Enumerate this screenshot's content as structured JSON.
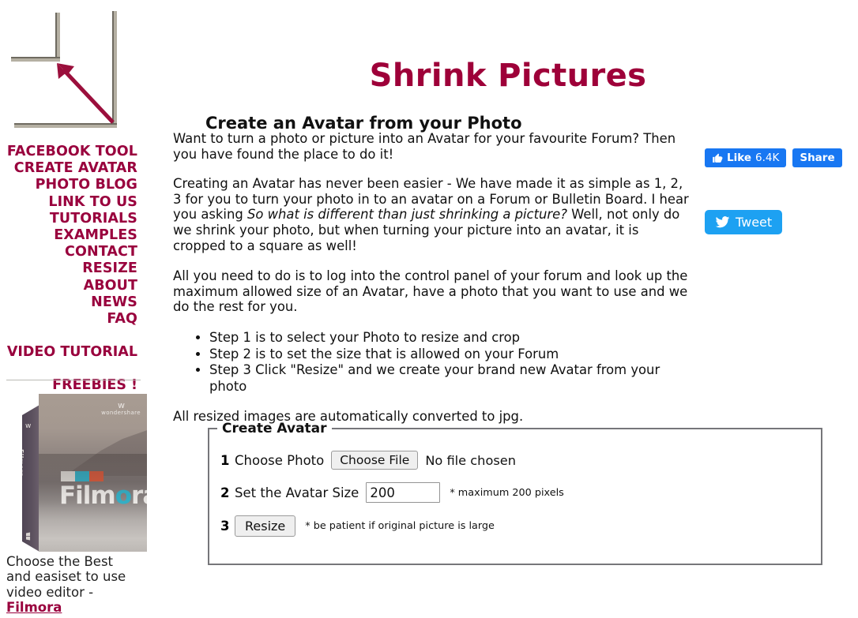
{
  "site": {
    "title": "Shrink Pictures",
    "logo_icon": "shrink-arrow-logo",
    "accent_color": "#99003d",
    "title_color": "#9e0039"
  },
  "sidebar": {
    "nav_items": [
      {
        "label": "FACEBOOK TOOL",
        "name": "facebook-tool"
      },
      {
        "label": "CREATE AVATAR",
        "name": "create-avatar"
      },
      {
        "label": "PHOTO BLOG",
        "name": "photo-blog"
      },
      {
        "label": "LINK TO US",
        "name": "link-to-us"
      },
      {
        "label": "TUTORIALS",
        "name": "tutorials"
      },
      {
        "label": "EXAMPLES",
        "name": "examples"
      },
      {
        "label": "CONTACT",
        "name": "contact"
      },
      {
        "label": "RESIZE",
        "name": "resize"
      },
      {
        "label": "ABOUT",
        "name": "about"
      },
      {
        "label": "NEWS",
        "name": "news"
      },
      {
        "label": "FAQ",
        "name": "faq"
      }
    ],
    "video_tutorial": "VIDEO TUTORIAL",
    "freebies": "FREEBIES !",
    "ad": {
      "product_name": "Filmora",
      "brand_mark": "wondershare",
      "spine_text": "Filmora",
      "caption_line1": "Choose the Best",
      "caption_line2": "and easiset to use",
      "caption_line3": "video editor -",
      "caption_brand": "Filmora"
    }
  },
  "main": {
    "heading": "Create an Avatar from your Photo",
    "paragraph_1": "Want to turn a photo or picture into an Avatar for your favourite Forum?  Then you have found the place to do it!",
    "paragraph_2_part1": "Creating an Avatar has never been easier - We have made it as simple as 1, 2, 3 for you to turn your photo in to an avatar on a Forum or Bulletin Board.  I hear you asking ",
    "paragraph_2_italic": "So what is different than just shrinking a picture?",
    "paragraph_2_part2": "  Well, not only do we shrink your photo, but when turning your picture into an avatar, it is cropped to a square as well!",
    "paragraph_3": "All you need to do is to log into the control panel of your forum and look up the maximum allowed size of an Avatar, have a photo that you want to use and we do the rest for you.",
    "steps": [
      "Step 1 is to select your Photo to resize and crop",
      "Step 2 is to set the size that is allowed on your Forum",
      "Step 3 Click \"Resize\" and we create your brand new Avatar from your photo"
    ],
    "paragraph_4": "All resized images are automatically converted to jpg."
  },
  "social": {
    "facebook_like_label": "Like",
    "facebook_like_count": "6.4K",
    "facebook_share_label": "Share",
    "twitter_label": "Tweet",
    "facebook_color": "#1877f2",
    "twitter_color": "#1da1f2"
  },
  "form": {
    "legend": "Create Avatar",
    "step1_number": "1",
    "step1_label": "Choose Photo",
    "step1_button": "Choose File",
    "step1_status": "No file chosen",
    "step2_number": "2",
    "step2_label": "Set the Avatar Size",
    "step2_value": "200",
    "step2_hint": "* maximum 200 pixels",
    "step3_number": "3",
    "step3_button": "Resize",
    "step3_hint": "* be patient if original picture is large"
  }
}
